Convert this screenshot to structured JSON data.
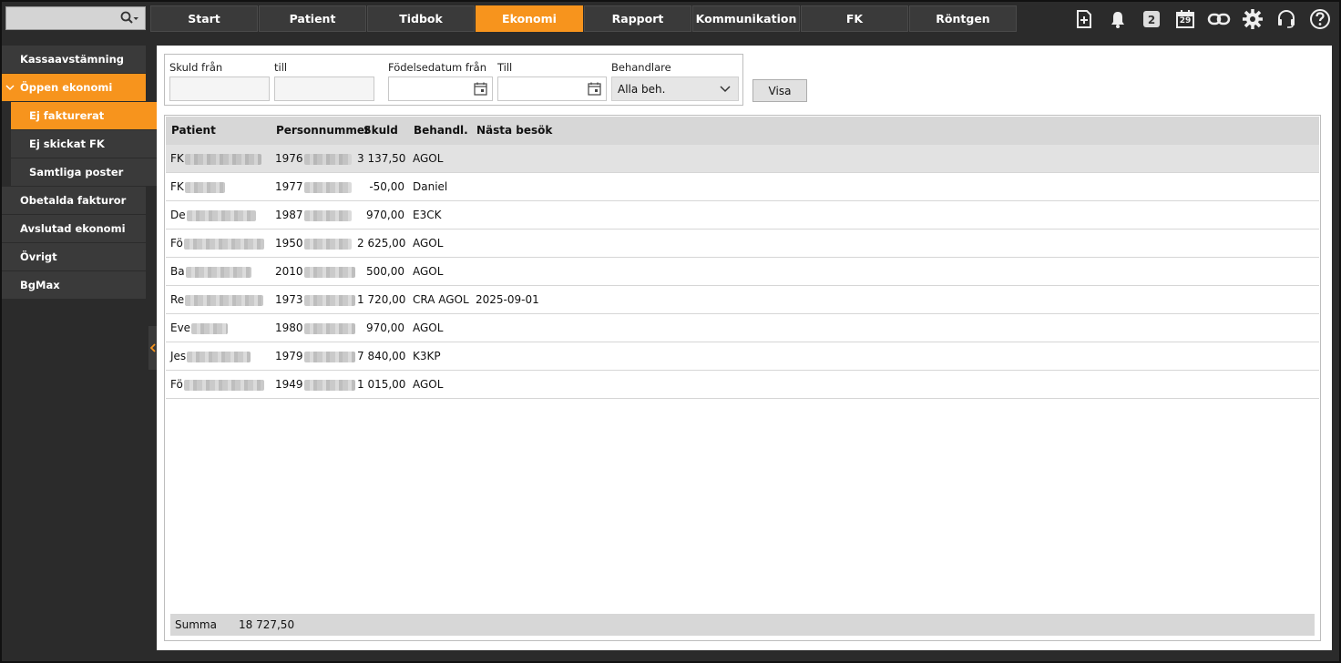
{
  "topbar": {
    "nav_tabs": [
      {
        "label": "Start",
        "active": false
      },
      {
        "label": "Patient",
        "active": false
      },
      {
        "label": "Tidbok",
        "active": false
      },
      {
        "label": "Ekonomi",
        "active": true
      },
      {
        "label": "Rapport",
        "active": false
      },
      {
        "label": "Kommunikation",
        "active": false
      },
      {
        "label": "FK",
        "active": false
      },
      {
        "label": "Röntgen",
        "active": false
      }
    ],
    "icons": [
      "new-document-icon",
      "bell-icon",
      "message-count-icon",
      "calendar-icon",
      "link-icon",
      "gear-icon",
      "headset-icon",
      "help-icon"
    ],
    "message_count": "2",
    "calendar_day": "29"
  },
  "sidebar": {
    "items": [
      {
        "label": "Kassaavstämning"
      },
      {
        "label": "Öppen ekonomi",
        "open": true
      },
      {
        "label": "Ej fakturerat",
        "sub": true,
        "active": true
      },
      {
        "label": "Ej skickat FK",
        "sub": true
      },
      {
        "label": "Samtliga poster",
        "sub": true
      },
      {
        "label": "Obetalda fakturor"
      },
      {
        "label": "Avslutad ekonomi"
      },
      {
        "label": "Övrigt"
      },
      {
        "label": "BgMax"
      }
    ]
  },
  "filters": {
    "skuld_fran_label": "Skuld från",
    "till_label": "till",
    "fodelsedatum_fran_label": "Födelsedatum från",
    "till2_label": "Till",
    "behandlare_label": "Behandlare",
    "behandlare_value": "Alla beh.",
    "visa_label": "Visa"
  },
  "table": {
    "headers": {
      "patient": "Patient",
      "pnr": "Personnummer",
      "skuld": "Skuld",
      "beh": "Behandl.",
      "next": "Nästa besök"
    },
    "rows": [
      {
        "patient": "FK",
        "pnr": "1976",
        "skuld": "3 137,50",
        "beh": "AGOL",
        "next": ""
      },
      {
        "patient": "FK",
        "pnr": "1977",
        "skuld": "-50,00",
        "beh": "Daniel",
        "next": ""
      },
      {
        "patient": "De",
        "pnr": "1987",
        "skuld": "970,00",
        "beh": "E3CK",
        "next": ""
      },
      {
        "patient": "Fö",
        "pnr": "1950",
        "skuld": "2 625,00",
        "beh": "AGOL",
        "next": ""
      },
      {
        "patient": "Ba",
        "pnr": "2010",
        "skuld": "500,00",
        "beh": "AGOL",
        "next": ""
      },
      {
        "patient": "Re",
        "pnr": "1973",
        "skuld": "1 720,00",
        "beh": "CRA AGOL",
        "next": "2025-09-01"
      },
      {
        "patient": "Eve",
        "pnr": "1980",
        "skuld": "970,00",
        "beh": "AGOL",
        "next": ""
      },
      {
        "patient": "Jes",
        "pnr": "1979",
        "skuld": "7 840,00",
        "beh": "K3KP",
        "next": ""
      },
      {
        "patient": "Fö",
        "pnr": "1949",
        "skuld": "1 015,00",
        "beh": "AGOL",
        "next": ""
      }
    ],
    "summa_label": "Summa",
    "summa_value": "18 727,50"
  },
  "colors": {
    "accent": "#f7941d",
    "dark": "#2b2b2b",
    "tab": "#3a3a3a"
  }
}
